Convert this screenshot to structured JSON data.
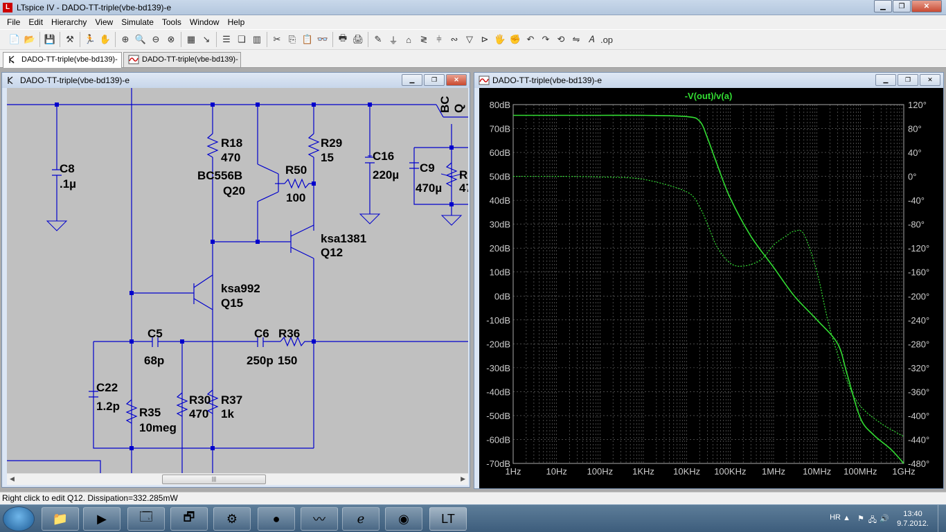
{
  "app": {
    "window_title": "LTspice IV - DADO-TT-triple(vbe-bd139)-e"
  },
  "menu": [
    "File",
    "Edit",
    "Hierarchy",
    "View",
    "Simulate",
    "Tools",
    "Window",
    "Help"
  ],
  "tabs": [
    {
      "label": "DADO-TT-triple(vbe-bd139)-e",
      "icon": "schematic-icon"
    },
    {
      "label": "DADO-TT-triple(vbe-bd139)-e",
      "icon": "waveform-icon"
    }
  ],
  "schematic_window": {
    "title": "DADO-TT-triple(vbe-bd139)-e",
    "scroll_grip": "|||"
  },
  "schematic": {
    "labels": {
      "C8": "C8",
      "C8v": ".1µ",
      "R18": "R18",
      "R18v": "470",
      "BC556B": "BC556B",
      "Q20": "Q20",
      "R29": "R29",
      "R29v": "15",
      "R50": "R50",
      "R50v": "100",
      "C16": "C16",
      "C16v": "220µ",
      "C9": "C9",
      "C9v": "470µ",
      "Rpart": "R",
      "Rpartv": "47",
      "BCpart": "BC",
      "Qpart": "Q",
      "ksa1381": "ksa1381",
      "Q12": "Q12",
      "ksa992": "ksa992",
      "Q15": "Q15",
      "C5": "C5",
      "C5v": "68p",
      "C6": "C6",
      "C6v": "250p",
      "R36": "R36",
      "R36v": "150",
      "C22": "C22",
      "C22v": "1.2p",
      "R35": "R35",
      "R35v": "10meg",
      "R30": "R30",
      "R30v": "470",
      "R37": "R37",
      "R37v": "1k"
    }
  },
  "plot_window": {
    "title": "DADO-TT-triple(vbe-bd139)-e",
    "trace_label": "-V(out)/v(a)",
    "left_axis": [
      "80dB",
      "70dB",
      "60dB",
      "50dB",
      "40dB",
      "30dB",
      "20dB",
      "10dB",
      "0dB",
      "-10dB",
      "-20dB",
      "-30dB",
      "-40dB",
      "-50dB",
      "-60dB",
      "-70dB"
    ],
    "right_axis": [
      "120°",
      "80°",
      "40°",
      "0°",
      "-40°",
      "-80°",
      "-120°",
      "-160°",
      "-200°",
      "-240°",
      "-280°",
      "-320°",
      "-360°",
      "-400°",
      "-440°",
      "-480°"
    ],
    "x_axis": [
      "1Hz",
      "10Hz",
      "100Hz",
      "1KHz",
      "10KHz",
      "100KHz",
      "1MHz",
      "10MHz",
      "100MHz",
      "1GHz"
    ]
  },
  "chart_data": {
    "type": "line",
    "title": "-V(out)/v(a)",
    "x_scale": "log",
    "xlim": [
      1,
      1000000000
    ],
    "ylim_left": [
      -70,
      80
    ],
    "ylim_right": [
      -480,
      120
    ],
    "grid": true,
    "trace_color": "#33dd33",
    "series": [
      {
        "axis": "magnitude",
        "style": "solid",
        "x": [
          1,
          10,
          100,
          1000,
          10000,
          20000,
          30000,
          50000,
          100000,
          300000,
          1000000,
          3000000,
          10000000,
          30000000,
          50000000,
          100000000,
          200000000,
          500000000,
          1000000000
        ],
        "y": [
          75.5,
          75.5,
          75.5,
          75.5,
          75,
          73,
          66,
          55,
          41,
          25,
          12,
          0,
          -10,
          -20,
          -33,
          -51,
          -58,
          -64,
          -70
        ]
      },
      {
        "axis": "phase",
        "style": "dotted",
        "x": [
          1,
          10,
          100,
          1000,
          10000,
          20000,
          30000,
          50000,
          100000,
          200000,
          500000,
          1000000,
          2000000,
          3000000,
          5000000,
          10000000,
          20000000,
          50000000,
          100000000,
          300000000,
          1000000000
        ],
        "y": [
          0,
          0,
          -1,
          -5,
          -26,
          -52,
          -80,
          -118,
          -145,
          -150,
          -140,
          -115,
          -99,
          -92,
          -97,
          -160,
          -255,
          -343,
          -384,
          -413,
          -435
        ]
      }
    ]
  },
  "status": {
    "text": "Right click to edit Q12.  Dissipation=332.285mW"
  },
  "tray": {
    "lang": "HR",
    "time": "13:40",
    "date": "9.7.2012."
  },
  "colors": {
    "wire": "#0000cc",
    "schematic_bg": "#c0c0c0",
    "plot_bg": "#000000",
    "trace": "#33dd33"
  }
}
